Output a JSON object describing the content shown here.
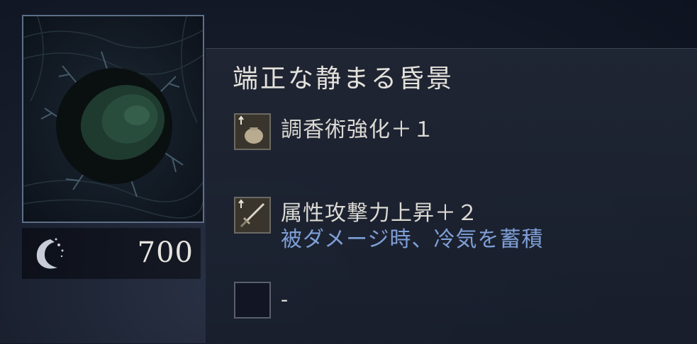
{
  "item": {
    "name": "端正な静まる昏景",
    "price": "700"
  },
  "effects": [
    {
      "icon": "perfume-bottle-icon",
      "label": "調香術強化＋１",
      "sub": ""
    },
    {
      "icon": "sword-icon",
      "label": "属性攻撃力上昇＋２",
      "sub": "被ダメージ時、冷気を蓄積"
    },
    {
      "icon": "empty-slot-icon",
      "label": "-",
      "sub": ""
    }
  ],
  "colors": {
    "subtext": "#7f9fd6",
    "thumbnail_border": "#5d6f88"
  }
}
